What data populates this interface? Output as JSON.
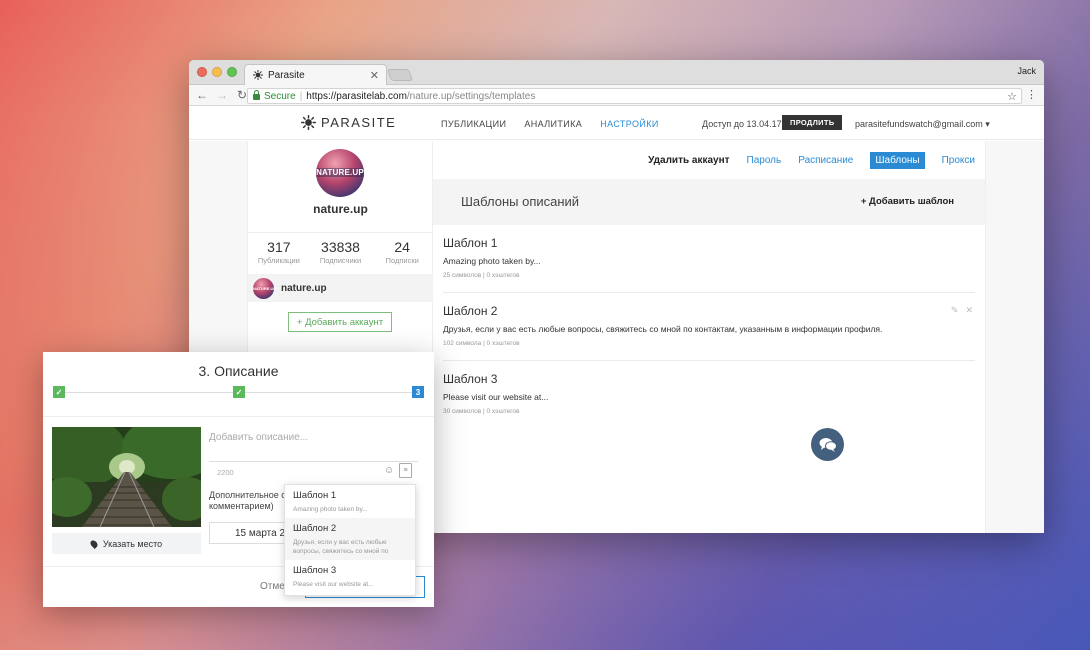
{
  "browser": {
    "tab_title": "Parasite",
    "profile": "Jack",
    "secure_label": "Secure",
    "url_host": "https://parasitelab.com",
    "url_path": "/nature.up/settings/templates"
  },
  "header": {
    "logo": "PARASITE",
    "nav": [
      "ПУБЛИКАЦИИ",
      "АНАЛИТИКА",
      "НАСТРОЙКИ"
    ],
    "active_nav": "НАСТРОЙКИ",
    "access": "Доступ до 13.04.17",
    "prolong": "ПРОДЛИТЬ",
    "email": "parasitefundswatch@gmail.com"
  },
  "profile": {
    "avatar_text": "NATURE.UP",
    "handle": "nature.up",
    "stats": [
      {
        "num": "317",
        "label": "Публикации"
      },
      {
        "num": "33838",
        "label": "Подписчики"
      },
      {
        "num": "24",
        "label": "Подписки"
      }
    ],
    "account": "nature.up",
    "add_account": "+ Добавить аккаунт"
  },
  "settings": {
    "tabs": {
      "delete": "Удалить аккаунт",
      "password": "Пароль",
      "schedule": "Расписание",
      "templates": "Шаблоны",
      "proxy": "Прокси"
    },
    "section_title": "Шаблоны описаний",
    "add_template": "+ Добавить шаблон",
    "templates": [
      {
        "name": "Шаблон 1",
        "text": "Amazing photo taken by...",
        "meta": "25 символов | 0 хэштегов"
      },
      {
        "name": "Шаблон 2",
        "text": "Друзья, если у вас есть любые вопросы, свяжитесь со мной по контактам, указанным в информации профиля.",
        "meta": "102 символа | 0 хэштегов"
      },
      {
        "name": "Шаблон 3",
        "text": "Please visit our website at...",
        "meta": "30 символов | 0 хэштегов"
      }
    ]
  },
  "modal": {
    "title": "3. Описание",
    "step3": "3",
    "location": "Указать место",
    "desc_placeholder": "Добавить описание...",
    "counter": "2200",
    "extra_line1": "Дополнительное оп",
    "extra_line2": "комментарием)",
    "date": "15 марта 20",
    "cancel": "Отме"
  },
  "dropdown": [
    {
      "name": "Шаблон 1",
      "text": "Amazing photo taken by..."
    },
    {
      "name": "Шаблон 2",
      "text_line1": "Друзья, если у вас есть любые",
      "text_line2": "вопросы, свяжитесь со мной по"
    },
    {
      "name": "Шаблон 3",
      "text": "Please visit our website at..."
    }
  ],
  "colors": {
    "accent": "#2a8bd4",
    "success": "#5ab95a",
    "chat": "#43607e"
  }
}
